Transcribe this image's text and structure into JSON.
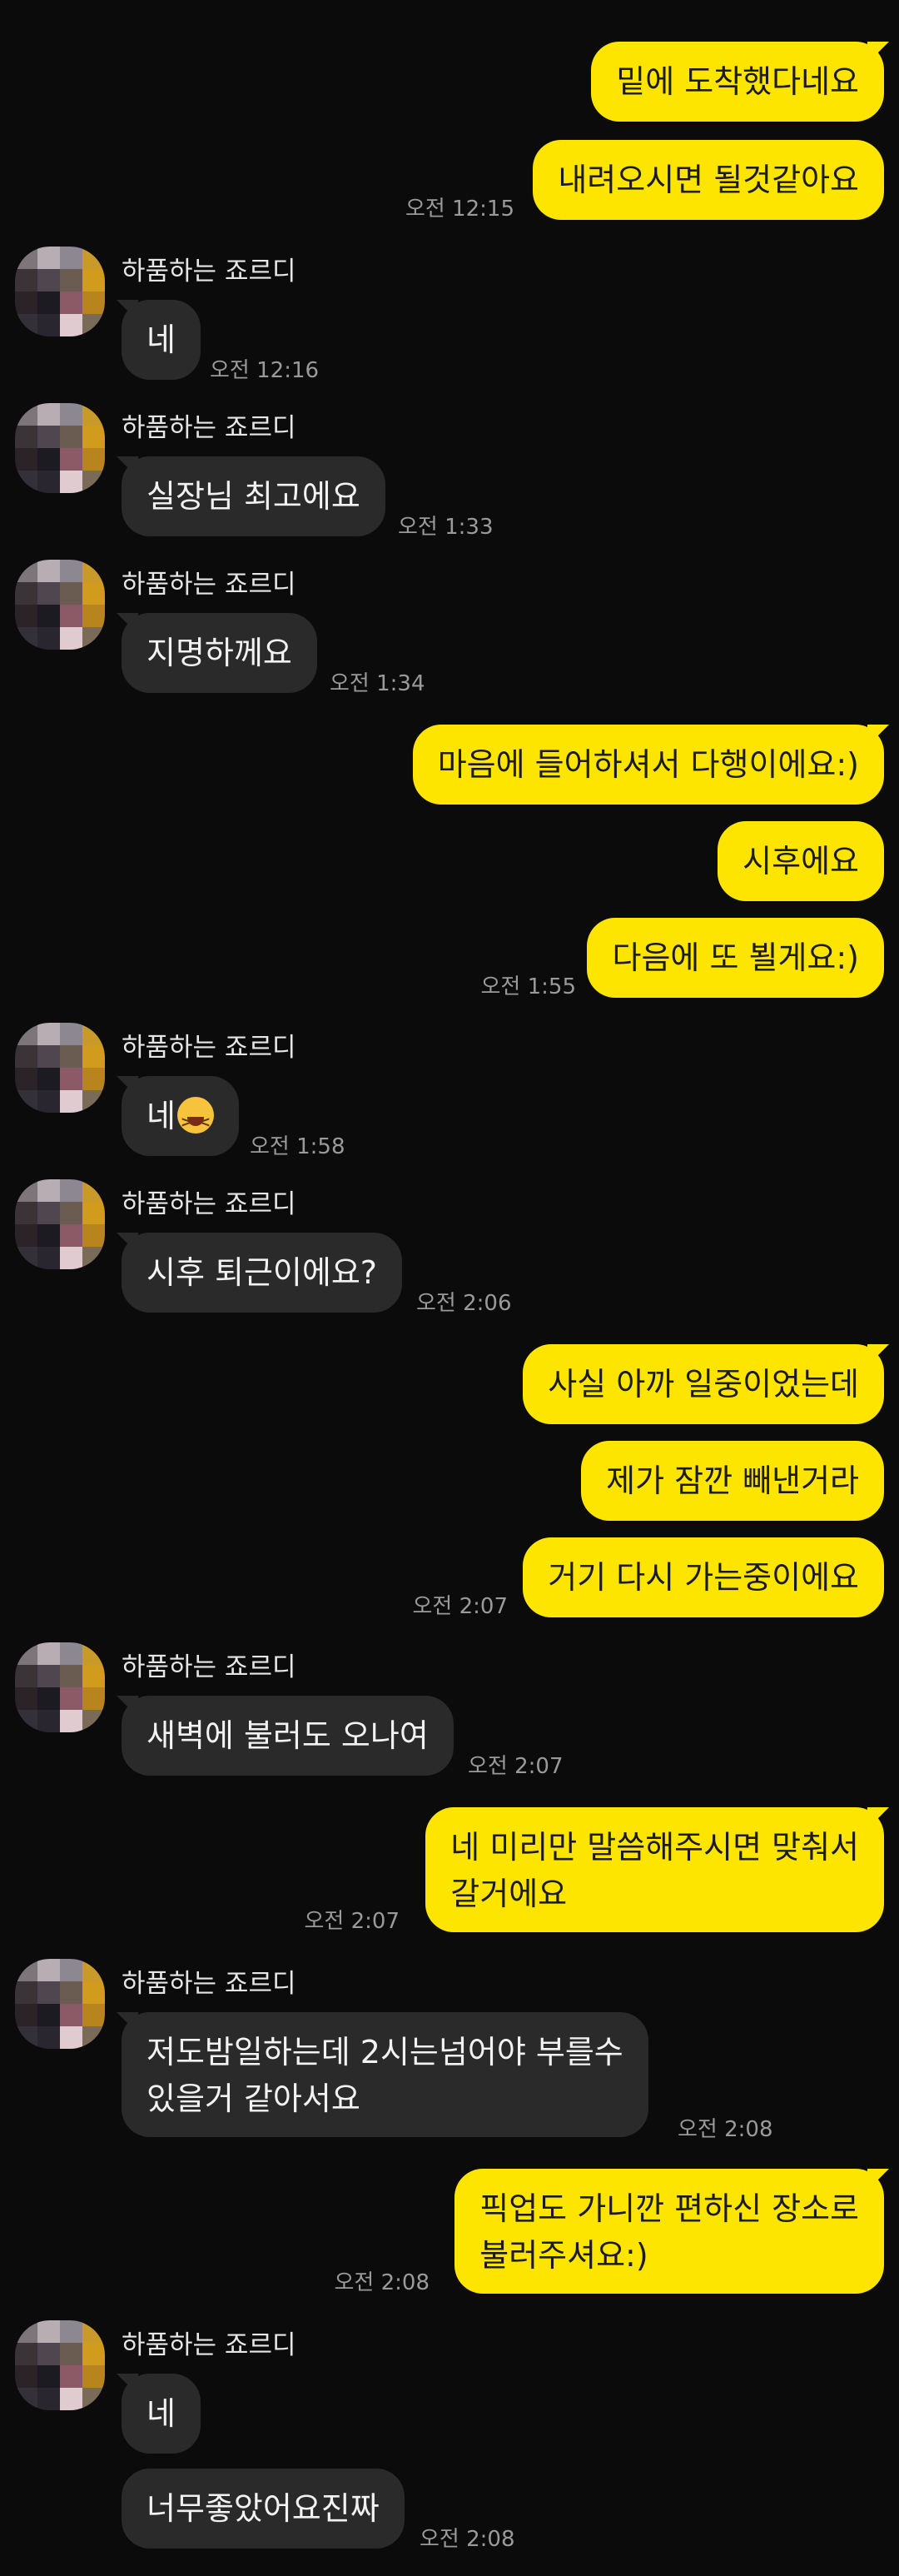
{
  "contact_name": "하품하는 죠르디",
  "colors": {
    "my_bubble": "#fee500",
    "their_bubble": "#2a2a2a",
    "background": "#0b0b0b"
  },
  "icons": {
    "avatar": "avatar-image",
    "emoji": "laughing-face-emoji"
  },
  "messages": [
    {
      "from": "me",
      "text": "밑에 도착했다네요"
    },
    {
      "from": "me",
      "text": "내려오시면 될것같아요",
      "time": "오전 12:15"
    },
    {
      "from": "them",
      "text": "네",
      "time": "오전 12:16"
    },
    {
      "from": "them",
      "text": "실장님 최고에요",
      "time": "오전 1:33"
    },
    {
      "from": "them",
      "text": "지명하께요",
      "time": "오전 1:34"
    },
    {
      "from": "me",
      "text": "마음에 들어하셔서 다행이에요:)"
    },
    {
      "from": "me",
      "text": "시후에요"
    },
    {
      "from": "me",
      "text": "다음에 또 뵐게요:)",
      "time": "오전 1:55"
    },
    {
      "from": "them",
      "text": "네",
      "emoji": "laughing-face-emoji",
      "time": "오전 1:58"
    },
    {
      "from": "them",
      "text": "시후 퇴근이에요?",
      "time": "오전 2:06"
    },
    {
      "from": "me",
      "text": "사실 아까 일중이었는데"
    },
    {
      "from": "me",
      "text": "제가 잠깐 빼낸거라"
    },
    {
      "from": "me",
      "text": "거기 다시 가는중이에요",
      "time": "오전 2:07"
    },
    {
      "from": "them",
      "text": "새벽에 불러도 오나여",
      "time": "오전 2:07"
    },
    {
      "from": "me",
      "lines": [
        "네 미리만 말씀해주시면 맞춰서",
        "갈거에요"
      ],
      "time": "오전 2:07"
    },
    {
      "from": "them",
      "lines": [
        "저도밤일하는데 2시는넘어야 부를수",
        "있을거 같아서요"
      ],
      "time": "오전 2:08"
    },
    {
      "from": "me",
      "lines": [
        "픽업도 가니깐 편하신 장소로",
        "불러주셔요:)"
      ],
      "time": "오전 2:08"
    },
    {
      "from": "them",
      "text": "네"
    },
    {
      "from": "them",
      "text": "너무좋았어요진짜",
      "time": "오전 2:08"
    }
  ]
}
